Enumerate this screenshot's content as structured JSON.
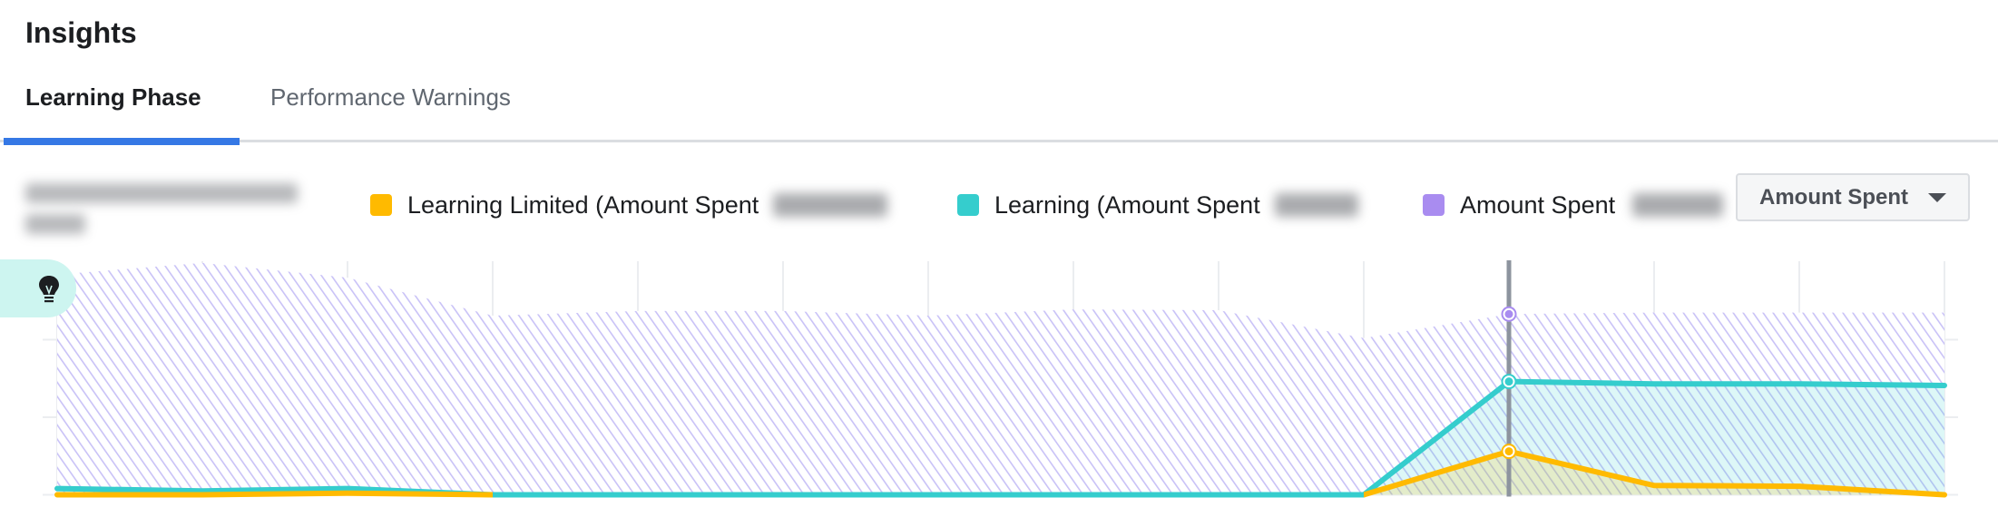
{
  "header": {
    "title": "Insights"
  },
  "tabs": [
    {
      "label": "Learning Phase",
      "active": true
    },
    {
      "label": "Performance Warnings",
      "active": false
    }
  ],
  "date_range": {
    "redacted": true
  },
  "dropdown": {
    "selected": "Amount Spent",
    "icon": "caret-down-icon"
  },
  "tip_badge": {
    "icon": "lightbulb-icon"
  },
  "colors": {
    "accent": "#3578e5",
    "learning_limited": "#ffba00",
    "learning": "#35cdcd",
    "amount_spent": "#a98cf0",
    "hover_line": "#8d949e",
    "grid": "#ebedf0",
    "tip_badge_bg": "#cdf5f0"
  },
  "chart_data": {
    "type": "area",
    "title": "",
    "xlabel": "",
    "ylabel": "",
    "y_ticks_labeled": false,
    "y_gridlines_relative": [
      0,
      1,
      2
    ],
    "ylim": [
      0,
      3.1
    ],
    "grid": true,
    "legend_position": "top",
    "x_count": 14,
    "highlighted_index": 10,
    "series": [
      {
        "name": "Learning Limited (Amount Spent",
        "value_redacted": true,
        "color": "#ffba00",
        "style": "line+fill",
        "values": [
          0,
          0,
          0.02,
          0,
          0,
          0,
          0,
          0,
          0,
          0,
          0.56,
          0.12,
          0.11,
          0
        ]
      },
      {
        "name": "Learning (Amount Spent",
        "value_redacted": true,
        "color": "#35cdcd",
        "style": "line+fill",
        "values": [
          0.08,
          0.05,
          0.08,
          0,
          0,
          0,
          0,
          0,
          0,
          0,
          1.46,
          1.43,
          1.43,
          1.41
        ]
      },
      {
        "name": "Amount Spent",
        "value_redacted": true,
        "color": "#a98cf0",
        "style": "hatched-area",
        "values": [
          2.84,
          2.99,
          2.8,
          2.31,
          2.37,
          2.37,
          2.31,
          2.39,
          2.38,
          2.02,
          2.33,
          2.35,
          2.35,
          2.35
        ]
      }
    ]
  }
}
